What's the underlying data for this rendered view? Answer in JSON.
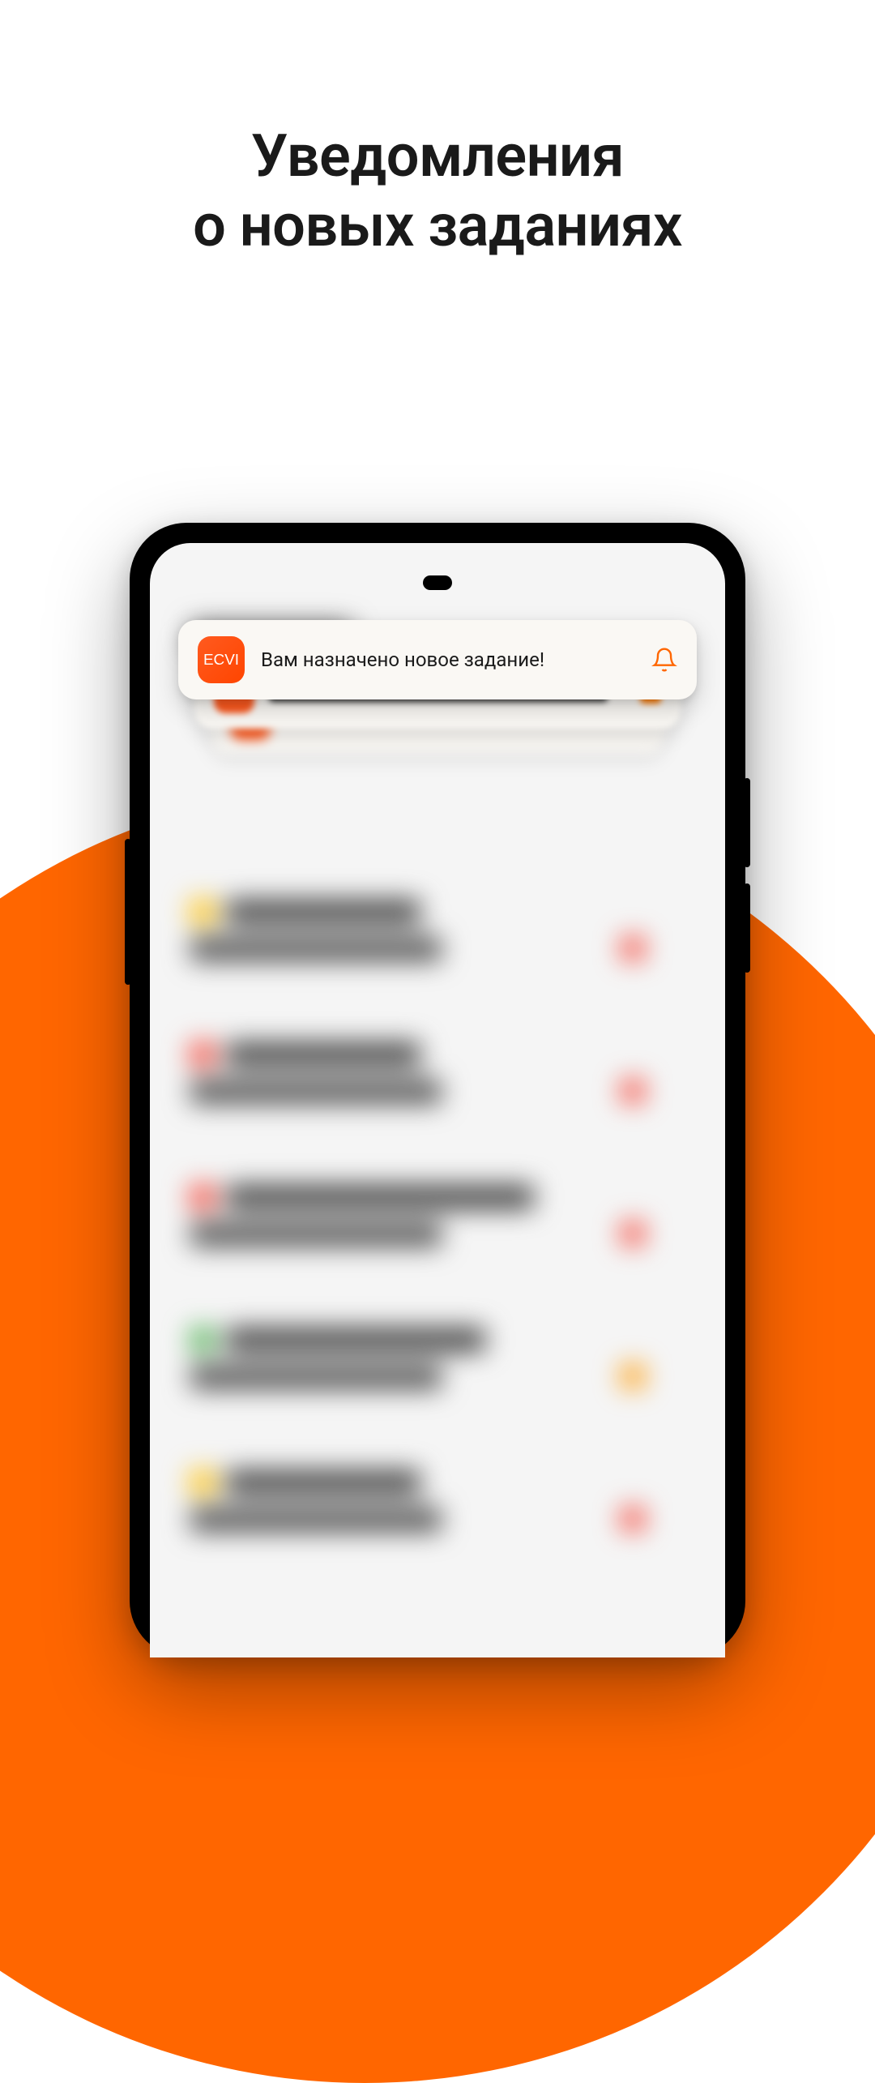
{
  "headline": {
    "line1": "Уведомления",
    "line2": "о новых заданиях"
  },
  "notification": {
    "app_name": "ECVI",
    "message": "Вам назначено новое задание!"
  },
  "colors": {
    "accent": "#ff6600",
    "notification_bg": "#faf8f4",
    "app_icon_bg": "#ff5a1f"
  }
}
